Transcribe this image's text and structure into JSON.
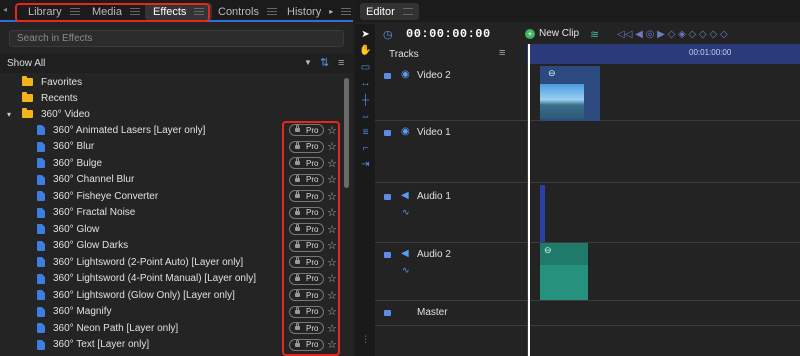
{
  "left_panel": {
    "tabs": [
      "Library",
      "Media",
      "Effects",
      "Controls",
      "History"
    ],
    "active_tab": "Effects",
    "search_placeholder": "Search in Effects",
    "filter": "Show All",
    "folders": [
      "Favorites",
      "Recents",
      "360° Video"
    ],
    "effects": [
      "360° Animated Lasers [Layer only]",
      "360° Blur",
      "360° Bulge",
      "360° Channel Blur",
      "360° Fisheye Converter",
      "360° Fractal Noise",
      "360° Glow",
      "360° Glow Darks",
      "360° Lightsword (2-Point Auto) [Layer only]",
      "360° Lightsword (4-Point Manual) [Layer only]",
      "360° Lightsword (Glow Only) [Layer only]",
      "360° Magnify",
      "360° Neon Path [Layer only]",
      "360° Text [Layer only]"
    ],
    "badge": "Pro",
    "accent": "#2f6fd6",
    "highlight": "#e8261c"
  },
  "editor": {
    "tab": "Editor",
    "timecode": "00:00:00:00",
    "new_clip": "New Clip",
    "tracks_label": "Tracks",
    "ruler_label": "00:01:00:00",
    "tracks": [
      "Video 2",
      "Video 1",
      "Audio 1",
      "Audio 2",
      "Master"
    ]
  }
}
